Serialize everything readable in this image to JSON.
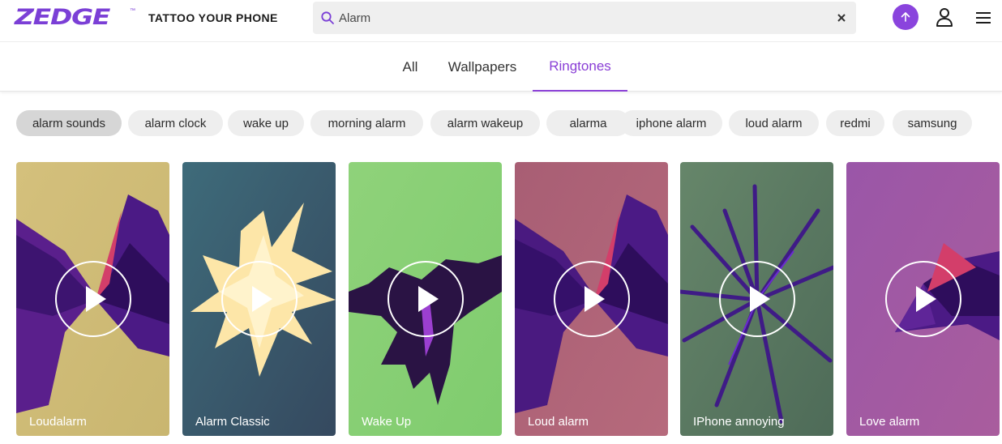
{
  "brand": {
    "logo_text": "ZEDGE",
    "tm": "™",
    "tagline": "TATTOO YOUR PHONE",
    "accent": "#8a3fd6"
  },
  "search": {
    "value": "Alarm",
    "placeholder": "Search"
  },
  "tabs": [
    {
      "label": "All",
      "active": false
    },
    {
      "label": "Wallpapers",
      "active": false
    },
    {
      "label": "Ringtones",
      "active": true
    }
  ],
  "chips": [
    {
      "label": "alarm sounds",
      "selected": true
    },
    {
      "label": "alarm clock"
    },
    {
      "label": "wake up"
    },
    {
      "label": "morning alarm"
    },
    {
      "label": "alarm wakeup"
    },
    {
      "label": "alarma"
    },
    {
      "label": "iphone alarm"
    },
    {
      "label": "loud alarm"
    },
    {
      "label": "redmi"
    },
    {
      "label": "samsung"
    }
  ],
  "ringtones": [
    {
      "title": "Loudalarm",
      "icon": "play-icon"
    },
    {
      "title": "Alarm Classic",
      "icon": "play-icon"
    },
    {
      "title": "Wake Up",
      "icon": "play-icon"
    },
    {
      "title": "Loud alarm",
      "icon": "play-icon"
    },
    {
      "title": "IPhone annoying",
      "icon": "play-icon"
    },
    {
      "title": "Love alarm",
      "icon": "play-icon"
    }
  ],
  "icons": {
    "search": "search-icon",
    "clear": "close-icon",
    "upload": "upload-arrow-icon",
    "account": "user-icon",
    "menu": "hamburger-menu-icon"
  }
}
